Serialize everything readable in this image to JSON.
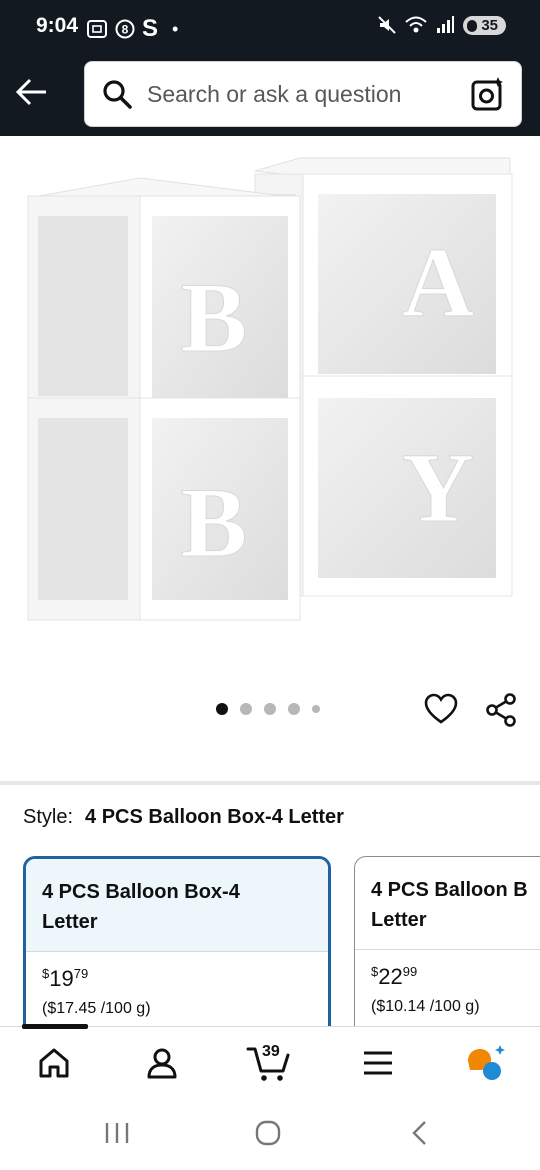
{
  "status_bar": {
    "time": "9:04",
    "left_icons": [
      "screenshot-icon",
      "sync-icon",
      "s-app-icon",
      "dot-icon"
    ],
    "s_glyph": "S",
    "dot_glyph": "•",
    "right_icons": [
      "mute-icon",
      "wifi-icon",
      "signal-icon"
    ],
    "battery": "35"
  },
  "search": {
    "placeholder": "Search or ask a question",
    "value": ""
  },
  "product": {
    "image_letters": [
      "B",
      "A",
      "B",
      "Y"
    ],
    "gallery_count": 5,
    "gallery_active": 1
  },
  "style": {
    "label": "Style:",
    "value": "4 PCS Balloon Box-4 Letter"
  },
  "options": [
    {
      "title_line1": "4 PCS Balloon Box-4",
      "title_line2": "Letter",
      "currency": "$",
      "dollars": "19",
      "cents": "79",
      "unit_price": "($17.45 /100 g)",
      "selected": true
    },
    {
      "title_line1": "4 PCS Balloon B",
      "title_line2": "Letter",
      "currency": "$",
      "dollars": "22",
      "cents": "99",
      "unit_price": "($10.14 /100 g)",
      "selected": false
    }
  ],
  "nav": {
    "items": [
      "home-icon",
      "account-icon",
      "cart-icon",
      "menu-icon",
      "rufus-icon"
    ],
    "cart_count": "39",
    "active": "home-icon"
  },
  "colors": {
    "header": "#131921",
    "selected_border": "#2162a1",
    "selected_bg": "#edf6fb",
    "rufus_orange": "#f08804",
    "rufus_blue": "#1f8ad6"
  }
}
